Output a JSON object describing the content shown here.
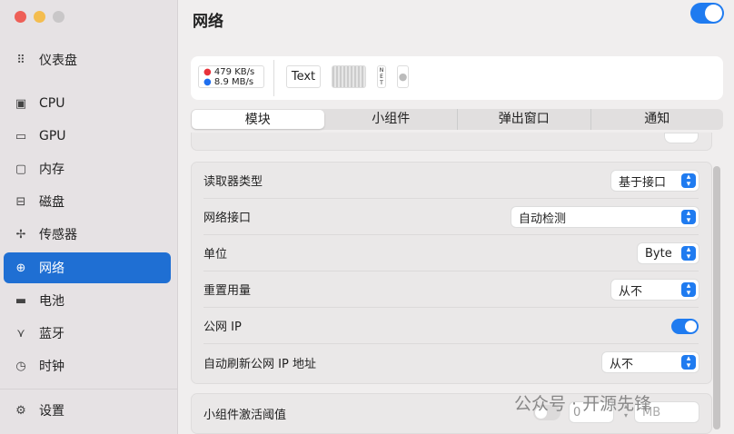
{
  "window": {
    "controls": {
      "close": "#ee5f57",
      "minimize": "#f4bd4f",
      "zoom": "#c9c7c8"
    }
  },
  "sidebar": {
    "items": [
      {
        "label": "仪表盘",
        "icon": "grid-icon"
      },
      {
        "label": "CPU",
        "icon": "cpu-icon"
      },
      {
        "label": "GPU",
        "icon": "monitor-icon"
      },
      {
        "label": "内存",
        "icon": "memory-icon"
      },
      {
        "label": "磁盘",
        "icon": "disk-icon"
      },
      {
        "label": "传感器",
        "icon": "fan-icon"
      },
      {
        "label": "网络",
        "icon": "globe-icon",
        "active": true
      },
      {
        "label": "电池",
        "icon": "battery-icon"
      },
      {
        "label": "蓝牙",
        "icon": "bluetooth-icon"
      },
      {
        "label": "时钟",
        "icon": "clock-icon"
      },
      {
        "label": "设置",
        "icon": "gear-icon"
      }
    ]
  },
  "header": {
    "title": "网络",
    "enabled": true
  },
  "preview": {
    "upload": "479 KB/s",
    "download": "8.9 MB/s",
    "text_widget": "Text",
    "net_label": "NET"
  },
  "tabs": [
    {
      "label": "模块",
      "active": true
    },
    {
      "label": "小组件"
    },
    {
      "label": "弹出窗口"
    },
    {
      "label": "通知"
    }
  ],
  "settings": [
    {
      "label": "读取器类型",
      "value": "基于接口"
    },
    {
      "label": "网络接口",
      "value": "自动检测"
    },
    {
      "label": "单位",
      "value": "Byte"
    },
    {
      "label": "重置用量",
      "value": "从不"
    },
    {
      "label": "公网 IP",
      "toggle": true
    },
    {
      "label": "自动刷新公网 IP 地址",
      "value": "从不"
    }
  ],
  "threshold": {
    "label": "小组件激活阈值",
    "enabled": false,
    "value": "0",
    "unit": "MB"
  },
  "watermark": "公众号 · 开源先锋",
  "colors": {
    "accent": "#1f6fd3",
    "upload_dot": "#e8323a",
    "download_dot": "#1f6fef"
  }
}
